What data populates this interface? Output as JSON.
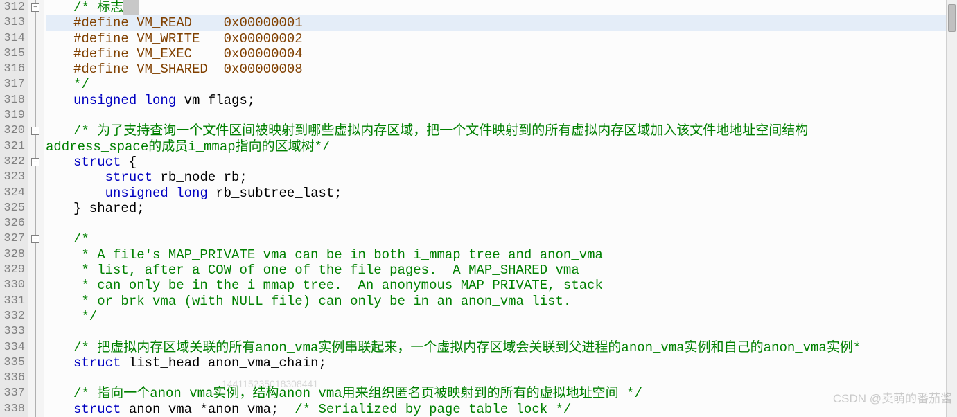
{
  "gutter": {
    "start": 312,
    "end": 338
  },
  "fold_markers": {
    "312": "minus",
    "320": "minus",
    "322": "minus",
    "327": "minus"
  },
  "highlight_line": 313,
  "selection_line": 312,
  "lines": {
    "312": [
      [
        "c",
        "/* "
      ],
      [
        "c",
        "标志"
      ],
      [
        "sel",
        "  "
      ]
    ],
    "313": [
      [
        "pp",
        "#define "
      ],
      [
        "pp",
        "VM_READ"
      ],
      [
        "pp",
        "    "
      ],
      [
        "pp",
        "0x00000001"
      ]
    ],
    "314": [
      [
        "pp",
        "#define "
      ],
      [
        "pp",
        "VM_WRITE"
      ],
      [
        "pp",
        "   "
      ],
      [
        "pp",
        "0x00000002"
      ]
    ],
    "315": [
      [
        "pp",
        "#define "
      ],
      [
        "pp",
        "VM_EXEC"
      ],
      [
        "pp",
        "    "
      ],
      [
        "pp",
        "0x00000004"
      ]
    ],
    "316": [
      [
        "pp",
        "#define "
      ],
      [
        "pp",
        "VM_SHARED"
      ],
      [
        "pp",
        "  "
      ],
      [
        "pp",
        "0x00000008"
      ]
    ],
    "317": [
      [
        "c",
        "*/"
      ]
    ],
    "318": [
      [
        "kw",
        "unsigned"
      ],
      [
        "blk",
        " "
      ],
      [
        "kw",
        "long"
      ],
      [
        "blk",
        " vm_flags;"
      ]
    ],
    "319": [],
    "320": [
      [
        "c",
        "/* 为了支持查询一个文件区间被映射到哪些虚拟内存区域，把一个文件映射到的所有虚拟内存区域加入该文件地地址空间结构"
      ]
    ],
    "321": [
      [
        "c_noindent",
        "address_space的成员i_mmap指向的区域树*/"
      ]
    ],
    "322": [
      [
        "kw",
        "struct"
      ],
      [
        "blk",
        " {"
      ]
    ],
    "323": [
      [
        "blk",
        "    "
      ],
      [
        "kw",
        "struct"
      ],
      [
        "blk",
        " rb_node rb;"
      ]
    ],
    "324": [
      [
        "blk",
        "    "
      ],
      [
        "kw",
        "unsigned"
      ],
      [
        "blk",
        " "
      ],
      [
        "kw",
        "long"
      ],
      [
        "blk",
        " rb_subtree_last;"
      ]
    ],
    "325": [
      [
        "blk",
        "} shared;"
      ]
    ],
    "326": [],
    "327": [
      [
        "c",
        "/*"
      ]
    ],
    "328": [
      [
        "c",
        " * A file's MAP_PRIVATE vma can be in both i_mmap tree and anon_vma"
      ]
    ],
    "329": [
      [
        "c",
        " * list, after a COW of one of the file pages.  A MAP_SHARED vma"
      ]
    ],
    "330": [
      [
        "c",
        " * can only be in the i_mmap tree.  An anonymous MAP_PRIVATE, stack"
      ]
    ],
    "331": [
      [
        "c",
        " * or brk vma (with NULL file) can only be in an anon_vma list."
      ]
    ],
    "332": [
      [
        "c",
        " */"
      ]
    ],
    "333": [],
    "334": [
      [
        "c",
        "/* 把虚拟内存区域关联的所有anon_vma实例串联起来，一个虚拟内存区域会关联到父进程的anon_vma实例和自己的anon_vma实例*"
      ]
    ],
    "335": [
      [
        "kw",
        "struct"
      ],
      [
        "blk",
        " list_head anon_vma_chain;"
      ]
    ],
    "336": [],
    "337": [
      [
        "c",
        "/* 指向一个anon_vma实例，结构anon_vma用来组织匿名页被映射到的所有的虚拟地址空间 */"
      ]
    ],
    "338": [
      [
        "kw",
        "struct"
      ],
      [
        "blk",
        " anon_vma *anon_vma;  "
      ],
      [
        "c",
        "/* Serialized by page_table_lock */"
      ]
    ]
  },
  "ghost_number": "144115235018308441",
  "watermark": "CSDN @卖萌的番茄酱"
}
